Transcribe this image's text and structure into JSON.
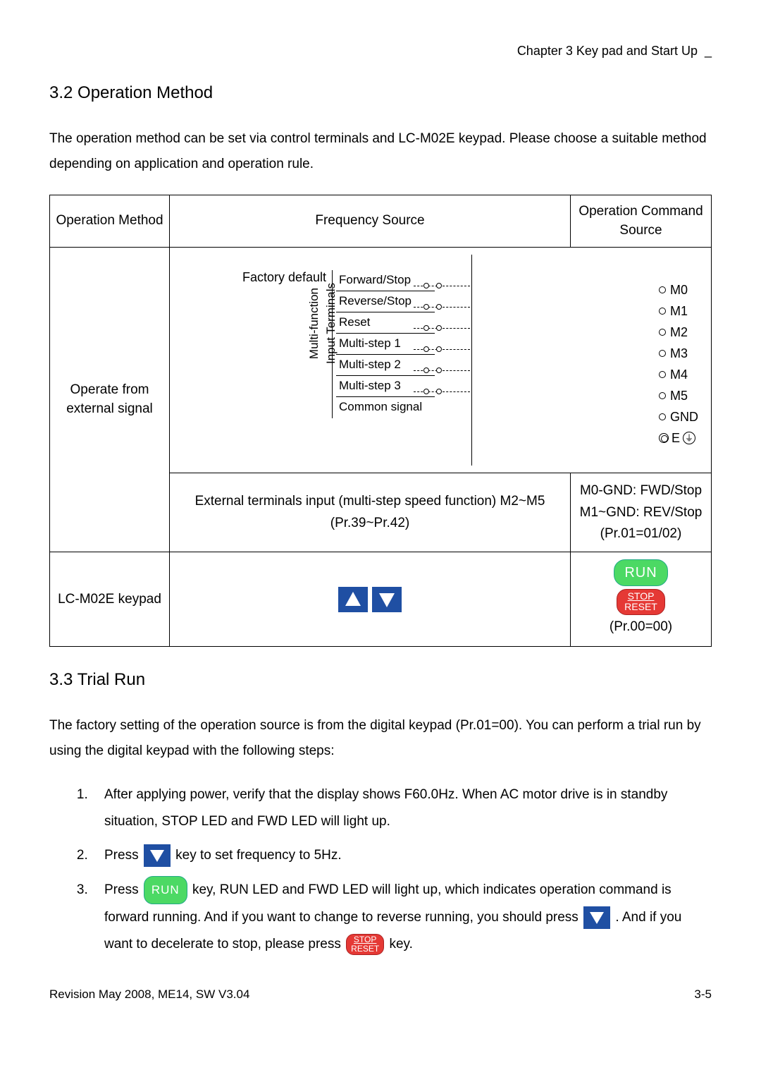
{
  "header": {
    "chapter": "Chapter 3 Key pad and Start Up"
  },
  "sections": {
    "op_method_title": "3.2 Operation Method",
    "op_method_intro": "The operation method can be set via control terminals and LC-M02E keypad. Please choose a suitable method depending on application and operation rule.",
    "trial_title": "3.3 Trial Run",
    "trial_intro": "The factory setting of the operation source is from the digital keypad (Pr.01=00). You can perform a trial run by using the digital keypad with the following steps:",
    "step1": "After applying power, verify that the display shows F60.0Hz. When AC motor drive is in standby situation, STOP LED and FWD LED will light up.",
    "step2_a": "Press ",
    "step2_b": " key to set frequency to 5Hz.",
    "step3_a": "Press ",
    "step3_b": " key, RUN LED and FWD LED will light up, which indicates operation command is forward running. And if you want to change to reverse running, you should press ",
    "step3_c": ". And if you want to decelerate to stop, please press ",
    "step3_d": " key."
  },
  "table": {
    "h1": "Operation Method",
    "h2": "Frequency Source",
    "h3": "Operation Command Source",
    "r1_label": "Operate from external signal",
    "factory_default": "Factory default",
    "vertical": "Multi-function\nInput Terminals",
    "signals": [
      "Forward/Stop",
      "Reverse/Stop",
      "Reset",
      "Multi-step 1",
      "Multi-step 2",
      "Multi-step 3",
      "Common signal"
    ],
    "terms": [
      "M0",
      "M1",
      "M2",
      "M3",
      "M4",
      "M5",
      "GND",
      "E"
    ],
    "ground_icon": "⏚",
    "r2_freq": "External terminals input (multi-step speed function) M2~M5 (Pr.39~Pr.42)",
    "r2_cmd_l1": "M0-GND: FWD/Stop",
    "r2_cmd_l2": "M1~GND: REV/Stop",
    "r2_cmd_l3": "(Pr.01=01/02)",
    "r3_label": "LC-M02E keypad",
    "run": "RUN",
    "stop": "STOP",
    "reset": "RESET",
    "r3_param": "(Pr.00=00)"
  },
  "footer": {
    "rev": "Revision May 2008, ME14, SW V3.04",
    "page": "3-5"
  }
}
